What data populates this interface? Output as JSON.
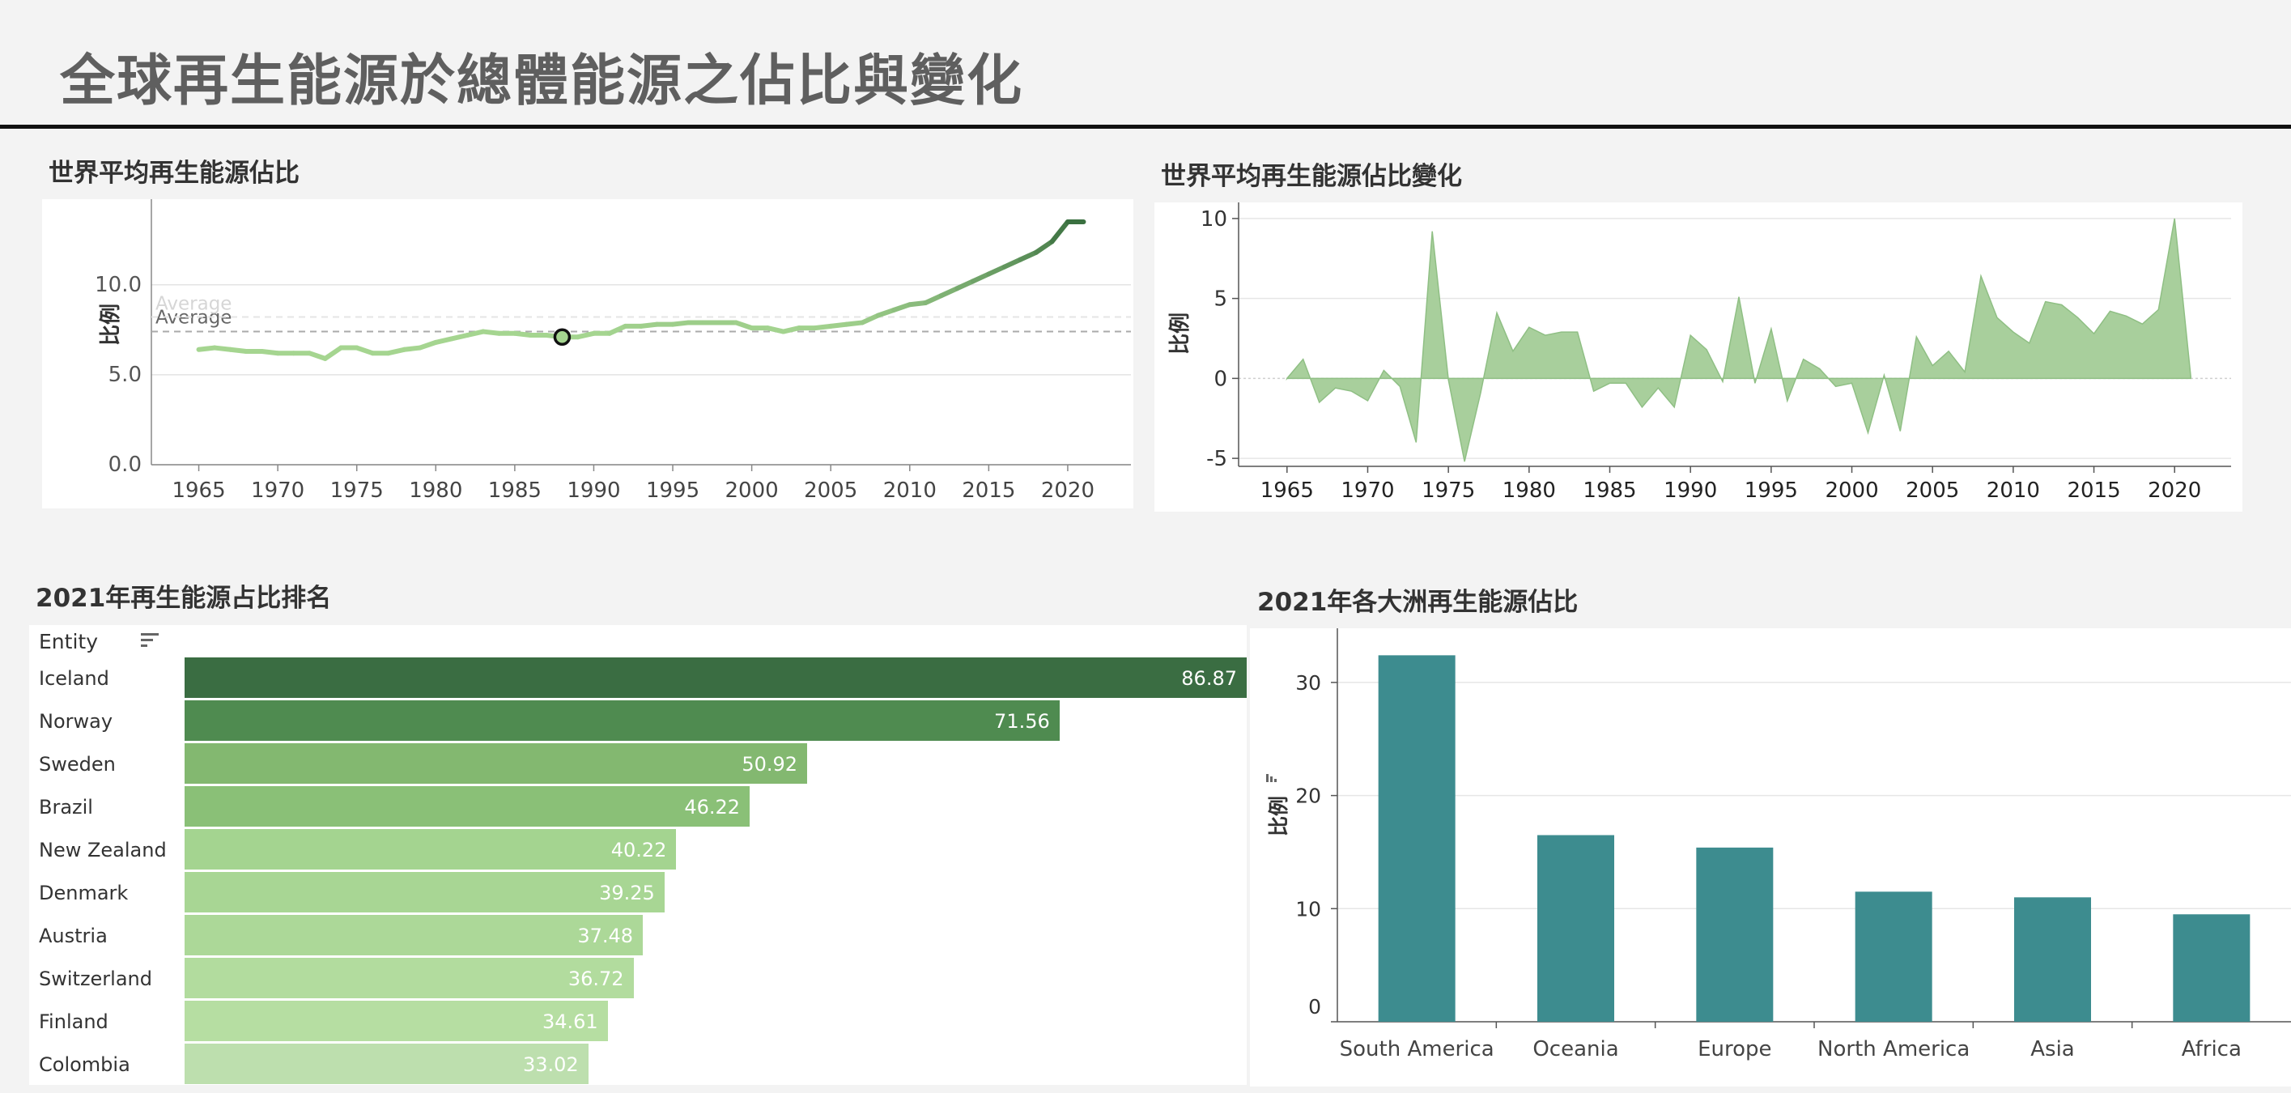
{
  "page": {
    "title": "全球再生能源於總體能源之佔比與變化"
  },
  "panels": {
    "world_avg": {
      "title": "世界平均再生能源佔比"
    },
    "world_change": {
      "title": "世界平均再生能源佔比變化"
    },
    "ranking": {
      "title": "2021年再生能源占比排名"
    },
    "continents": {
      "title": "2021年各大洲再生能源佔比"
    }
  },
  "chart_data": [
    {
      "type": "line",
      "title": "世界平均再生能源佔比",
      "xlabel": "",
      "ylabel": "比例",
      "x": [
        1965,
        1966,
        1967,
        1968,
        1969,
        1970,
        1971,
        1972,
        1973,
        1974,
        1975,
        1976,
        1977,
        1978,
        1979,
        1980,
        1981,
        1982,
        1983,
        1984,
        1985,
        1986,
        1987,
        1988,
        1989,
        1990,
        1991,
        1992,
        1993,
        1994,
        1995,
        1996,
        1997,
        1998,
        1999,
        2000,
        2001,
        2002,
        2003,
        2004,
        2005,
        2006,
        2007,
        2008,
        2009,
        2010,
        2011,
        2012,
        2013,
        2014,
        2015,
        2016,
        2017,
        2018,
        2019,
        2020,
        2021
      ],
      "values": [
        6.4,
        6.5,
        6.4,
        6.3,
        6.3,
        6.2,
        6.2,
        6.2,
        5.9,
        6.5,
        6.5,
        6.2,
        6.2,
        6.4,
        6.5,
        6.8,
        7.0,
        7.2,
        7.4,
        7.3,
        7.3,
        7.2,
        7.2,
        7.1,
        7.1,
        7.3,
        7.3,
        7.7,
        7.7,
        7.8,
        7.8,
        7.9,
        7.9,
        7.9,
        7.9,
        7.6,
        7.6,
        7.4,
        7.6,
        7.6,
        7.7,
        7.8,
        7.9,
        8.3,
        8.6,
        8.9,
        9.0,
        9.4,
        9.8,
        10.2,
        10.6,
        11.0,
        11.4,
        11.8,
        12.4,
        13.5,
        13.5
      ],
      "average": 7.4,
      "average_label": "Average",
      "highlighted_x": 1988,
      "ylim": [
        0,
        13.5
      ],
      "yticks": [
        "0.0",
        "5.0",
        "10.0"
      ],
      "xticks": [
        1965,
        1970,
        1975,
        1980,
        1985,
        1990,
        1995,
        2000,
        2005,
        2010,
        2015,
        2020
      ],
      "color_light": "#a5d590",
      "color_dark": "#3a7040"
    },
    {
      "type": "area",
      "title": "世界平均再生能源佔比變化",
      "xlabel": "",
      "ylabel": "比例",
      "x": [
        1965,
        1966,
        1967,
        1968,
        1969,
        1970,
        1971,
        1972,
        1973,
        1974,
        1975,
        1976,
        1977,
        1978,
        1979,
        1980,
        1981,
        1982,
        1983,
        1984,
        1985,
        1986,
        1987,
        1988,
        1989,
        1990,
        1991,
        1992,
        1993,
        1994,
        1995,
        1996,
        1997,
        1998,
        1999,
        2000,
        2001,
        2002,
        2003,
        2004,
        2005,
        2006,
        2007,
        2008,
        2009,
        2010,
        2011,
        2012,
        2013,
        2014,
        2015,
        2016,
        2017,
        2018,
        2019,
        2020,
        2021
      ],
      "values": [
        0.0,
        1.2,
        -1.5,
        -0.6,
        -0.8,
        -1.4,
        0.5,
        -0.5,
        -4.0,
        9.2,
        -0.1,
        -5.2,
        -0.9,
        4.1,
        1.7,
        3.2,
        2.7,
        2.9,
        2.9,
        -0.8,
        -0.3,
        -0.3,
        -1.8,
        -0.6,
        -1.8,
        2.7,
        1.8,
        -0.2,
        5.1,
        -0.3,
        3.1,
        -1.4,
        1.2,
        0.6,
        -0.5,
        -0.3,
        -3.4,
        0.2,
        -3.3,
        2.6,
        0.8,
        1.7,
        0.4,
        6.4,
        3.8,
        2.9,
        2.2,
        4.8,
        4.6,
        3.8,
        2.8,
        4.2,
        3.9,
        3.4,
        4.3,
        10.0,
        0.1
      ],
      "ylim": [
        -5.5,
        10.5
      ],
      "yticks": [
        "-5",
        "0",
        "5",
        "10"
      ],
      "xticks": [
        1965,
        1970,
        1975,
        1980,
        1985,
        1990,
        1995,
        2000,
        2005,
        2010,
        2015,
        2020
      ],
      "fill": "#a8cf9c",
      "stroke": "#8fbf84"
    },
    {
      "type": "bar",
      "title": "2021年再生能源占比排名",
      "column_header": "Entity",
      "categories": [
        "Iceland",
        "Norway",
        "Sweden",
        "Brazil",
        "New Zealand",
        "Denmark",
        "Austria",
        "Switzerland",
        "Finland",
        "Colombia"
      ],
      "values": [
        "86.87",
        "71.56",
        "50.92",
        "46.22",
        "40.22",
        "39.25",
        "37.48",
        "36.72",
        "34.61",
        "33.02"
      ],
      "colors": [
        "#3a6d42",
        "#4f8b50",
        "#83b870",
        "#8ac077",
        "#a4d490",
        "#a8d694",
        "#acd898",
        "#b2dc9e",
        "#b6dea2",
        "#bddfae"
      ]
    },
    {
      "type": "bar",
      "title": "2021年各大洲再生能源佔比",
      "xlabel": "",
      "ylabel": "比例",
      "categories": [
        "South America",
        "Oceania",
        "Europe",
        "North America",
        "Asia",
        "Africa"
      ],
      "values": [
        32.4,
        16.5,
        15.4,
        11.5,
        11.0,
        9.5
      ],
      "ylim": [
        0,
        33.5
      ],
      "yticks": [
        "0",
        "10",
        "20",
        "30"
      ],
      "color": "#3d8c8f"
    }
  ]
}
